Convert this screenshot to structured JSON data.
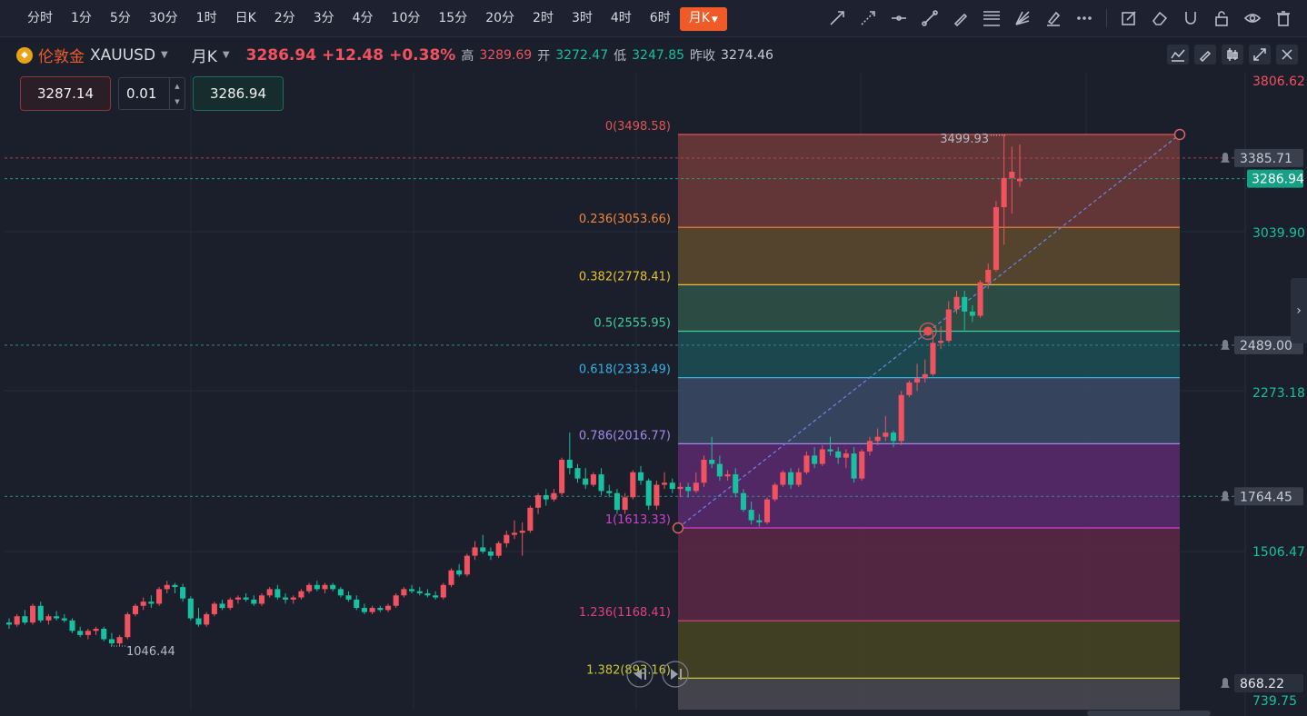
{
  "toolbar": {
    "periods": [
      "分时",
      "1分",
      "5分",
      "30分",
      "1时",
      "日K",
      "2分",
      "3分",
      "4分",
      "10分",
      "15分",
      "20分",
      "2时",
      "3时",
      "4时",
      "6时"
    ],
    "active_period": "月K",
    "tools": [
      "trend-line-icon",
      "ray-icon",
      "horizontal-line-icon",
      "segment-icon",
      "pen-icon",
      "fibonacci-icon",
      "fan-icon",
      "highlighter-icon",
      "more-icon",
      "note-icon",
      "eraser-icon",
      "magnet-icon",
      "lock-icon",
      "eye-icon",
      "trash-icon"
    ]
  },
  "symbol": {
    "name": "伦敦金",
    "code": "XAUUSD",
    "period": "月K",
    "price": "3286.94",
    "change": "+12.48",
    "change_pct": "+0.38%",
    "high_label": "高",
    "high": "3289.69",
    "open_label": "开",
    "open": "3272.47",
    "low_label": "低",
    "low": "3247.85",
    "prev_label": "昨收",
    "prev": "3274.46"
  },
  "trade": {
    "sell": "3287.14",
    "lot": "0.01",
    "buy": "3286.94"
  },
  "colors": {
    "up": "#f0525f",
    "down": "#16c0a0",
    "accent": "#f05a28"
  },
  "chart_data": {
    "type": "candlestick",
    "price_axis_labels": [
      "3806.62",
      "3385.71",
      "3286.94",
      "3039.90",
      "2489.00",
      "2273.18",
      "1764.45",
      "1506.47",
      "868.22",
      "739.75"
    ],
    "annotations": {
      "high_label": "3499.93",
      "low_label": "1046.44"
    },
    "fibonacci": {
      "levels": [
        {
          "label": "0(3498.58)",
          "ratio": 0,
          "price": 3498.58,
          "color": "#e05454",
          "fill": "#6e3a3a"
        },
        {
          "label": "0.236(3053.66)",
          "ratio": 0.236,
          "price": 3053.66,
          "color": "#f0873c",
          "fill": "#5e4a2e"
        },
        {
          "label": "0.382(2778.41)",
          "ratio": 0.382,
          "price": 2778.41,
          "color": "#e8c230",
          "fill": "#2f5447"
        },
        {
          "label": "0.5(2555.95)",
          "ratio": 0.5,
          "price": 2555.95,
          "color": "#3ccf9a",
          "fill": "#1d4f55"
        },
        {
          "label": "0.618(2333.49)",
          "ratio": 0.618,
          "price": 2333.49,
          "color": "#35b0e0",
          "fill": "#3b4a66"
        },
        {
          "label": "0.786(2016.77)",
          "ratio": 0.786,
          "price": 2016.77,
          "color": "#a089e8",
          "fill": "#5a2a6e"
        },
        {
          "label": "1(1613.33)",
          "ratio": 1,
          "price": 1613.33,
          "color": "#d040d0",
          "fill": "#5c2845"
        },
        {
          "label": "1.236(1168.41)",
          "ratio": 1.236,
          "price": 1168.41,
          "color": "#e04080",
          "fill": "#474523"
        },
        {
          "label": "1.382(893.16)",
          "ratio": 1.382,
          "price": 893.16,
          "color": "#c8c830",
          "fill": "#4a4a52"
        }
      ]
    },
    "candles": [
      [
        1160,
        1180,
        1130,
        1150
      ],
      [
        1150,
        1200,
        1140,
        1190
      ],
      [
        1190,
        1220,
        1150,
        1160
      ],
      [
        1160,
        1250,
        1150,
        1240
      ],
      [
        1240,
        1260,
        1160,
        1170
      ],
      [
        1170,
        1200,
        1150,
        1190
      ],
      [
        1190,
        1215,
        1170,
        1180
      ],
      [
        1180,
        1200,
        1160,
        1170
      ],
      [
        1170,
        1180,
        1110,
        1120
      ],
      [
        1120,
        1140,
        1090,
        1100
      ],
      [
        1100,
        1130,
        1080,
        1120
      ],
      [
        1120,
        1140,
        1100,
        1130
      ],
      [
        1130,
        1140,
        1070,
        1080
      ],
      [
        1080,
        1110,
        1046,
        1060
      ],
      [
        1060,
        1100,
        1050,
        1090
      ],
      [
        1090,
        1210,
        1080,
        1200
      ],
      [
        1200,
        1250,
        1190,
        1240
      ],
      [
        1240,
        1280,
        1220,
        1260
      ],
      [
        1260,
        1290,
        1230,
        1250
      ],
      [
        1250,
        1330,
        1240,
        1320
      ],
      [
        1320,
        1360,
        1300,
        1340
      ],
      [
        1340,
        1350,
        1300,
        1330
      ],
      [
        1330,
        1345,
        1260,
        1275
      ],
      [
        1275,
        1285,
        1170,
        1180
      ],
      [
        1180,
        1230,
        1140,
        1150
      ],
      [
        1150,
        1210,
        1140,
        1200
      ],
      [
        1200,
        1260,
        1190,
        1250
      ],
      [
        1250,
        1270,
        1220,
        1230
      ],
      [
        1230,
        1280,
        1220,
        1270
      ],
      [
        1270,
        1290,
        1250,
        1280
      ],
      [
        1280,
        1300,
        1260,
        1270
      ],
      [
        1270,
        1290,
        1240,
        1250
      ],
      [
        1250,
        1300,
        1240,
        1290
      ],
      [
        1290,
        1330,
        1280,
        1320
      ],
      [
        1320,
        1340,
        1270,
        1280
      ],
      [
        1280,
        1300,
        1250,
        1270
      ],
      [
        1270,
        1290,
        1250,
        1280
      ],
      [
        1280,
        1320,
        1270,
        1310
      ],
      [
        1310,
        1350,
        1300,
        1340
      ],
      [
        1340,
        1360,
        1310,
        1320
      ],
      [
        1320,
        1350,
        1300,
        1340
      ],
      [
        1340,
        1350,
        1310,
        1320
      ],
      [
        1320,
        1330,
        1280,
        1290
      ],
      [
        1290,
        1310,
        1260,
        1270
      ],
      [
        1270,
        1290,
        1220,
        1230
      ],
      [
        1230,
        1250,
        1200,
        1210
      ],
      [
        1210,
        1240,
        1200,
        1230
      ],
      [
        1230,
        1240,
        1210,
        1220
      ],
      [
        1220,
        1250,
        1210,
        1240
      ],
      [
        1240,
        1300,
        1230,
        1290
      ],
      [
        1290,
        1330,
        1280,
        1320
      ],
      [
        1320,
        1340,
        1300,
        1310
      ],
      [
        1310,
        1330,
        1290,
        1300
      ],
      [
        1300,
        1320,
        1280,
        1290
      ],
      [
        1290,
        1310,
        1270,
        1280
      ],
      [
        1280,
        1350,
        1270,
        1340
      ],
      [
        1340,
        1420,
        1330,
        1410
      ],
      [
        1410,
        1440,
        1380,
        1390
      ],
      [
        1390,
        1490,
        1380,
        1480
      ],
      [
        1480,
        1550,
        1460,
        1520
      ],
      [
        1520,
        1580,
        1490,
        1500
      ],
      [
        1500,
        1520,
        1460,
        1480
      ],
      [
        1480,
        1550,
        1470,
        1540
      ],
      [
        1540,
        1600,
        1520,
        1580
      ],
      [
        1580,
        1650,
        1560,
        1590
      ],
      [
        1590,
        1640,
        1480,
        1600
      ],
      [
        1600,
        1720,
        1590,
        1710
      ],
      [
        1710,
        1780,
        1680,
        1770
      ],
      [
        1770,
        1800,
        1720,
        1750
      ],
      [
        1750,
        1800,
        1740,
        1780
      ],
      [
        1780,
        1950,
        1770,
        1940
      ],
      [
        1940,
        2070,
        1870,
        1900
      ],
      [
        1900,
        1920,
        1830,
        1850
      ],
      [
        1850,
        1900,
        1800,
        1820
      ],
      [
        1820,
        1880,
        1810,
        1870
      ],
      [
        1870,
        1900,
        1770,
        1790
      ],
      [
        1790,
        1820,
        1760,
        1780
      ],
      [
        1780,
        1800,
        1680,
        1700
      ],
      [
        1700,
        1780,
        1680,
        1760
      ],
      [
        1760,
        1890,
        1750,
        1880
      ],
      [
        1880,
        1910,
        1820,
        1840
      ],
      [
        1840,
        1850,
        1700,
        1720
      ],
      [
        1720,
        1840,
        1700,
        1820
      ],
      [
        1820,
        1880,
        1800,
        1830
      ],
      [
        1830,
        1850,
        1780,
        1800
      ],
      [
        1800,
        1830,
        1760,
        1810
      ],
      [
        1810,
        1830,
        1760,
        1790
      ],
      [
        1790,
        1880,
        1780,
        1830
      ],
      [
        1830,
        1960,
        1810,
        1940
      ],
      [
        1940,
        2050,
        1900,
        1920
      ],
      [
        1920,
        1960,
        1840,
        1860
      ],
      [
        1860,
        1890,
        1840,
        1870
      ],
      [
        1870,
        1900,
        1760,
        1780
      ],
      [
        1780,
        1800,
        1690,
        1700
      ],
      [
        1700,
        1740,
        1630,
        1650
      ],
      [
        1650,
        1680,
        1620,
        1640
      ],
      [
        1640,
        1760,
        1630,
        1750
      ],
      [
        1750,
        1830,
        1740,
        1820
      ],
      [
        1820,
        1890,
        1810,
        1880
      ],
      [
        1880,
        1900,
        1800,
        1820
      ],
      [
        1820,
        1900,
        1810,
        1880
      ],
      [
        1880,
        1980,
        1870,
        1960
      ],
      [
        1960,
        2000,
        1900,
        1920
      ],
      [
        1920,
        2010,
        1910,
        1990
      ],
      [
        1990,
        2050,
        1960,
        1980
      ],
      [
        1980,
        2000,
        1920,
        1950
      ],
      [
        1950,
        1990,
        1900,
        1970
      ],
      [
        1970,
        2000,
        1830,
        1850
      ],
      [
        1850,
        1990,
        1840,
        1980
      ],
      [
        1980,
        2050,
        1960,
        2030
      ],
      [
        2030,
        2090,
        2010,
        2050
      ],
      [
        2050,
        2150,
        2030,
        2070
      ],
      [
        2070,
        2080,
        2000,
        2030
      ],
      [
        2030,
        2270,
        2010,
        2250
      ],
      [
        2250,
        2320,
        2240,
        2310
      ],
      [
        2310,
        2400,
        2270,
        2330
      ],
      [
        2330,
        2420,
        2310,
        2350
      ],
      [
        2350,
        2550,
        2340,
        2500
      ],
      [
        2500,
        2580,
        2470,
        2510
      ],
      [
        2510,
        2700,
        2500,
        2660
      ],
      [
        2660,
        2750,
        2640,
        2720
      ],
      [
        2720,
        2750,
        2560,
        2650
      ],
      [
        2650,
        2680,
        2600,
        2630
      ],
      [
        2630,
        2800,
        2620,
        2790
      ],
      [
        2790,
        2880,
        2760,
        2850
      ],
      [
        2850,
        3180,
        2840,
        3150
      ],
      [
        3150,
        3499.93,
        2970,
        3290
      ],
      [
        3290,
        3440,
        3120,
        3320
      ],
      [
        3274.46,
        3450,
        3247.85,
        3286.94
      ]
    ]
  }
}
